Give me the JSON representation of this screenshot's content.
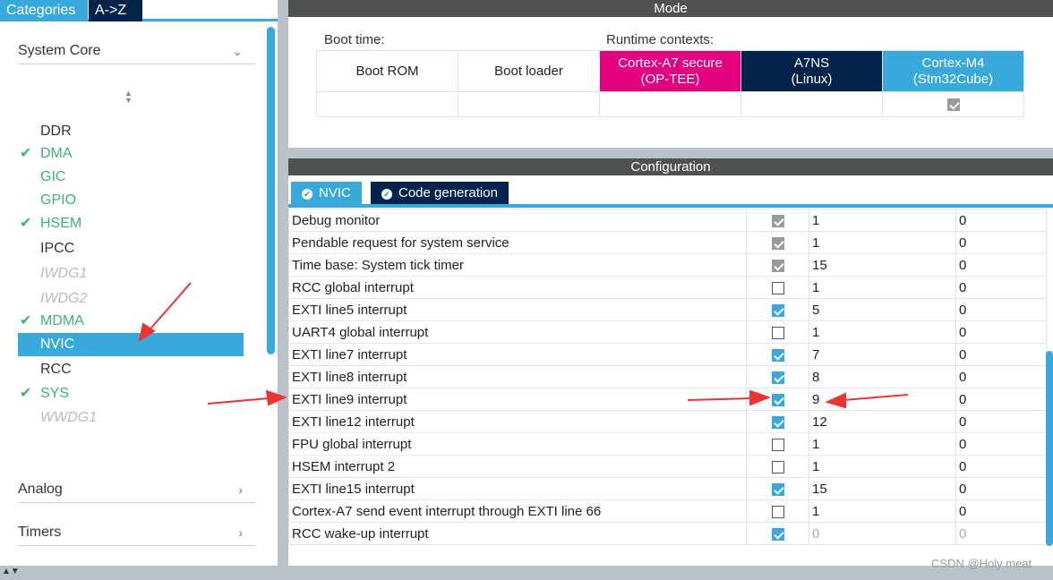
{
  "sidebar": {
    "tabs": [
      {
        "label": "Categories",
        "active": true
      },
      {
        "label": "A->Z",
        "active": false
      }
    ],
    "categories": [
      {
        "label": "System Core",
        "expanded": true
      },
      {
        "label": "Analog",
        "expanded": false
      },
      {
        "label": "Timers",
        "expanded": false
      }
    ],
    "items": [
      {
        "label": "DDR",
        "state": "normal",
        "checked": false
      },
      {
        "label": "DMA",
        "state": "green",
        "checked": true
      },
      {
        "label": "GIC",
        "state": "green",
        "checked": false
      },
      {
        "label": "GPIO",
        "state": "green",
        "checked": false
      },
      {
        "label": "HSEM",
        "state": "green",
        "checked": true
      },
      {
        "label": "IPCC",
        "state": "normal",
        "checked": false
      },
      {
        "label": "IWDG1",
        "state": "disabled",
        "checked": false
      },
      {
        "label": "IWDG2",
        "state": "disabled",
        "checked": false
      },
      {
        "label": "MDMA",
        "state": "green",
        "checked": true
      },
      {
        "label": "NVIC",
        "state": "selected",
        "checked": false
      },
      {
        "label": "RCC",
        "state": "normal",
        "checked": false
      },
      {
        "label": "SYS",
        "state": "green",
        "checked": true
      },
      {
        "label": "WWDG1",
        "state": "disabled",
        "checked": false
      }
    ]
  },
  "mode": {
    "title": "Mode",
    "boot_time_label": "Boot time:",
    "runtime_label": "Runtime contexts:",
    "columns": [
      {
        "line1": "Boot ROM",
        "line2": "",
        "color": "#ffffff",
        "checked": null
      },
      {
        "line1": "Boot loader",
        "line2": "",
        "color": "#ffffff",
        "checked": null
      },
      {
        "line1": "Cortex-A7 secure",
        "line2": "(OP-TEE)",
        "color": "#e4007f",
        "checked": null
      },
      {
        "line1": "A7NS",
        "line2": "(Linux)",
        "color": "#03234b",
        "checked": null
      },
      {
        "line1": "Cortex-M4",
        "line2": "(Stm32Cube)",
        "color": "#39a9dc",
        "checked": true
      }
    ]
  },
  "configuration": {
    "title": "Configuration",
    "tabs": [
      {
        "label": "NVIC",
        "active": true
      },
      {
        "label": "Code generation",
        "active": false
      }
    ],
    "rows": [
      {
        "name": "Debug monitor",
        "enabled": "disabled",
        "priority": "1",
        "sub": "0"
      },
      {
        "name": "Pendable request for system service",
        "enabled": "disabled",
        "priority": "1",
        "sub": "0"
      },
      {
        "name": "Time base: System tick timer",
        "enabled": "disabled",
        "priority": "15",
        "sub": "0"
      },
      {
        "name": "RCC global interrupt",
        "enabled": "off",
        "priority": "1",
        "sub": "0"
      },
      {
        "name": "EXTI line5 interrupt",
        "enabled": "on",
        "priority": "5",
        "sub": "0"
      },
      {
        "name": "UART4 global interrupt",
        "enabled": "off",
        "priority": "1",
        "sub": "0"
      },
      {
        "name": "EXTI line7 interrupt",
        "enabled": "on",
        "priority": "7",
        "sub": "0"
      },
      {
        "name": "EXTI line8 interrupt",
        "enabled": "on",
        "priority": "8",
        "sub": "0"
      },
      {
        "name": "EXTI line9 interrupt",
        "enabled": "on",
        "priority": "9",
        "sub": "0"
      },
      {
        "name": "EXTI line12 interrupt",
        "enabled": "on",
        "priority": "12",
        "sub": "0"
      },
      {
        "name": "FPU global interrupt",
        "enabled": "off",
        "priority": "1",
        "sub": "0"
      },
      {
        "name": "HSEM interrupt 2",
        "enabled": "off",
        "priority": "1",
        "sub": "0"
      },
      {
        "name": "EXTI line15 interrupt",
        "enabled": "on",
        "priority": "15",
        "sub": "0"
      },
      {
        "name": "Cortex-A7 send event interrupt through EXTI line 66",
        "enabled": "off",
        "priority": "1",
        "sub": "0"
      },
      {
        "name": "RCC wake-up interrupt",
        "enabled": "on",
        "priority": "0",
        "sub": "0",
        "greyed": true
      }
    ]
  },
  "watermark": "CSDN @Holy meat",
  "colors": {
    "accent": "#39a9dc",
    "header": "#505251",
    "navy": "#03234b",
    "magenta": "#e4007f",
    "green": "#3cb371",
    "annotation": "#ee3333"
  }
}
